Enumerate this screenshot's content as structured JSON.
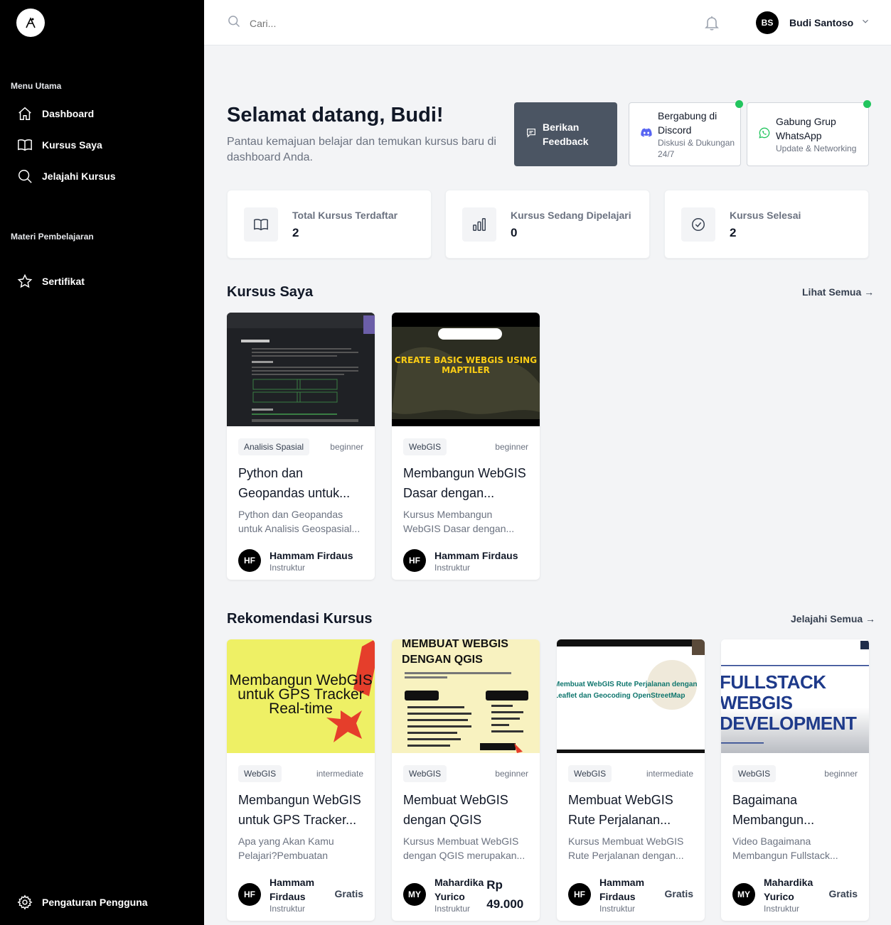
{
  "sidebar": {
    "section_main": "Menu Utama",
    "items_main": [
      {
        "label": "Dashboard"
      },
      {
        "label": "Kursus Saya"
      },
      {
        "label": "Jelajahi Kursus"
      }
    ],
    "section_materials": "Materi Pembelajaran",
    "certificate": "Sertifikat",
    "settings": "Pengaturan Pengguna"
  },
  "topbar": {
    "search_placeholder": "Cari...",
    "user_initials": "BS",
    "user_name": "Budi Santoso"
  },
  "welcome": {
    "title": "Selamat datang, Budi!",
    "subtitle": "Pantau kemajuan belajar dan temukan kursus baru di dashboard Anda."
  },
  "feedback": {
    "label": "Berikan Feedback"
  },
  "community": [
    {
      "title": "Bergabung di Discord",
      "subtitle": "Diskusi & Dukungan 24/7"
    },
    {
      "title": "Gabung Grup WhatsApp",
      "subtitle": "Update & Networking"
    }
  ],
  "stats": [
    {
      "label": "Total Kursus Terdaftar",
      "value": "2",
      "icon": "book-icon"
    },
    {
      "label": "Kursus Sedang Dipelajari",
      "value": "0",
      "icon": "bar-chart-icon"
    },
    {
      "label": "Kursus Selesai",
      "value": "2",
      "icon": "check-circle-icon"
    }
  ],
  "my_courses": {
    "title": "Kursus Saya",
    "link": "Lihat Semua →",
    "items": [
      {
        "category": "Analisis Spasial",
        "level": "beginner",
        "title": "Python dan Geopandas untuk...",
        "description": "Python dan Geopandas untuk Analisis Geospasial...",
        "instructor_initials": "HF",
        "instructor": "Hammam Firdaus",
        "role": "Instruktur"
      },
      {
        "category": "WebGIS",
        "level": "beginner",
        "title": "Membangun WebGIS Dasar dengan...",
        "description": "Kursus Membangun WebGIS Dasar dengan...",
        "instructor_initials": "HF",
        "instructor": "Hammam Firdaus",
        "role": "Instruktur",
        "thumb_text": "CREATE BASIC WEBGIS USING MAPTILER"
      }
    ]
  },
  "recommended": {
    "title": "Rekomendasi Kursus",
    "link": "Jelajahi Semua →",
    "items": [
      {
        "category": "WebGIS",
        "level": "intermediate",
        "title": "Membangun WebGIS untuk GPS Tracker...",
        "description": "Apa yang Akan Kamu Pelajari?Pembuatan aplika...",
        "instructor_initials": "HF",
        "instructor": "Hammam Firdaus",
        "role": "Instruktur",
        "price": "Gratis",
        "thumb_text": "Membangun WebGIS untuk GPS Tracker Real-time"
      },
      {
        "category": "WebGIS",
        "level": "beginner",
        "title": "Membuat WebGIS dengan QGIS",
        "description": "Kursus Membuat WebGIS dengan QGIS merupakan...",
        "instructor_initials": "MY",
        "instructor": "Mahardika Yurico",
        "role": "Instruktur",
        "price": "Rp 49.000",
        "thumb_text": "MEMBUAT WEBGIS DENGAN QGIS"
      },
      {
        "category": "WebGIS",
        "level": "intermediate",
        "title": "Membuat WebGIS Rute Perjalanan...",
        "description": "Kursus Membuat WebGIS Rute Perjalanan dengan...",
        "instructor_initials": "HF",
        "instructor": "Hammam Firdaus",
        "role": "Instruktur",
        "price": "Gratis",
        "thumb_text": "Membuat WebGIS Rute Perjalanan dengan Leaflet dan Geocoding OpenStreetMap"
      },
      {
        "category": "WebGIS",
        "level": "beginner",
        "title": "Bagaimana Membangun...",
        "description": "Video Bagaimana Membangun Fullstack...",
        "instructor_initials": "MY",
        "instructor": "Mahardika Yurico",
        "role": "Instruktur",
        "price": "Gratis",
        "thumb_text": "FULLSTACK WEBGIS DEVELOPMENT"
      }
    ]
  },
  "colors": {
    "sidebar_bg": "#000000",
    "accent": "#4b5563",
    "online": "#22c55e"
  }
}
